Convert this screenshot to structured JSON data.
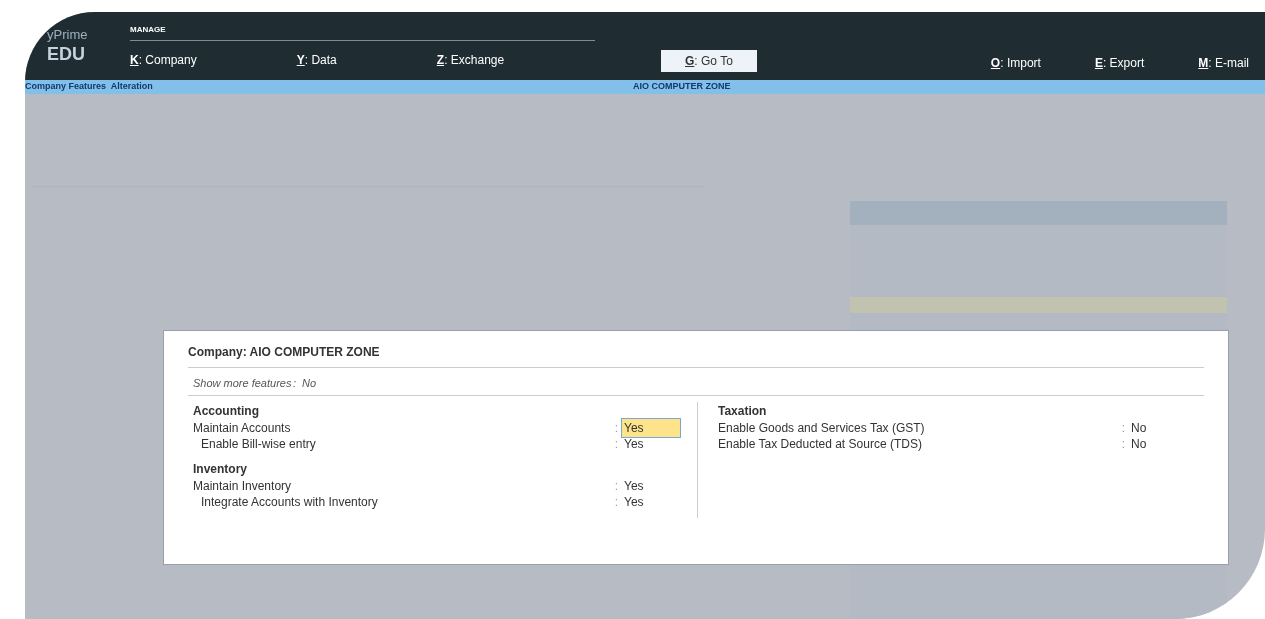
{
  "brand": {
    "line1": "yPrime",
    "line2": "EDU"
  },
  "top_bar": {
    "section": "MANAGE",
    "items": [
      {
        "kind": "menu",
        "key": "K",
        "separator": ":",
        "label": "Company"
      },
      {
        "kind": "menu",
        "key": "Y",
        "separator": ":",
        "label": "Data"
      },
      {
        "kind": "menu",
        "key": "Z",
        "separator": ":",
        "label": "Exchange"
      },
      {
        "kind": "button",
        "key": "G",
        "separator": ":",
        "label": "Go To"
      },
      {
        "kind": "menu",
        "key": "O",
        "separator": ":",
        "label": "Import"
      },
      {
        "kind": "menu",
        "key": "E",
        "separator": ":",
        "label": "Export"
      },
      {
        "kind": "menu",
        "key": "M",
        "separator": ":",
        "label": "E-mail"
      }
    ]
  },
  "title_bar": {
    "left": "Company Features  Alteration",
    "center": "AIO COMPUTER ZONE"
  },
  "dialog": {
    "title": "Company: AIO COMPUTER ZONE",
    "show_more": {
      "label": "Show more features",
      "separator": ":",
      "value": "No"
    },
    "columns": [
      {
        "sections": [
          {
            "heading": "Accounting",
            "fields": [
              {
                "label": "Maintain Accounts",
                "separator": ":",
                "value": "Yes",
                "focused": true,
                "children": [
                  {
                    "label": "Enable Bill-wise entry",
                    "separator": ":",
                    "value": "Yes",
                    "focused": false
                  }
                ]
              }
            ]
          },
          {
            "heading": "Inventory",
            "fields": [
              {
                "label": "Maintain Inventory",
                "separator": ":",
                "value": "Yes",
                "focused": false,
                "children": [
                  {
                    "label": "Integrate Accounts with Inventory",
                    "separator": ":",
                    "value": "Yes",
                    "focused": false
                  }
                ]
              }
            ]
          }
        ]
      },
      {
        "sections": [
          {
            "heading": "Taxation",
            "fields": [
              {
                "label": "Enable Goods and Services Tax (GST)",
                "separator": ":",
                "value": "No",
                "focused": false
              },
              {
                "label": "Enable Tax Deducted at Source (TDS)",
                "separator": ":",
                "value": "No",
                "focused": false
              }
            ]
          }
        ]
      }
    ]
  }
}
